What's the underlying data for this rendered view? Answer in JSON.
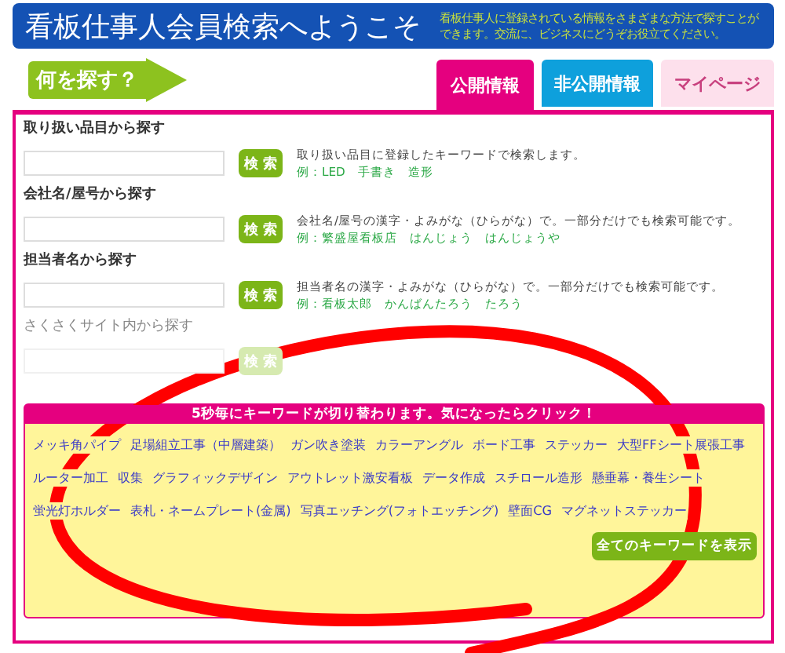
{
  "header": {
    "title": "看板仕事人会員検索へようこそ",
    "description": "看板仕事人に登録されている情報をさまざまな方法で探すことができます。交流に、ビジネスにどうぞお役立てください。"
  },
  "what_label": "何を探す？",
  "tabs": [
    {
      "label": "公開情報",
      "selected": true,
      "disabled": false,
      "color": "#e5007f"
    },
    {
      "label": "非公開情報",
      "selected": false,
      "disabled": false,
      "color": "#0ea0dc"
    },
    {
      "label": "マイページ",
      "selected": false,
      "disabled": true,
      "color": "#fde0ec"
    }
  ],
  "searches": [
    {
      "label": "取り扱い品目から探す",
      "button": "検 索",
      "description": "取り扱い品目に登録したキーワードで検索します。",
      "example": "例：LED　手書き　造形",
      "disabled": false
    },
    {
      "label": "会社名/屋号から探す",
      "button": "検 索",
      "description": "会社名/屋号の漢字・よみがな（ひらがな）で。一部分だけでも検索可能です。",
      "example": "例：繁盛屋看板店　はんじょう　はんじょうや",
      "disabled": false
    },
    {
      "label": "担当者名から探す",
      "button": "検 索",
      "description": "担当者名の漢字・よみがな（ひらがな）で。一部分だけでも検索可能です。",
      "example": "例：看板太郎　かんばんたろう　たろう",
      "disabled": false
    },
    {
      "label": "さくさくサイト内から探す",
      "button": "検 索",
      "disabled": true
    }
  ],
  "keywords": {
    "heading": "5秒毎にキーワードが切り替わります。気になったらクリック！",
    "items": [
      "メッキ角パイプ",
      "足場組立工事（中層建築）",
      "ガン吹き塗装",
      "カラーアングル",
      "ボード工事",
      "ステッカー",
      "大型FFシート展張工事",
      "ルーター加工",
      "収集",
      "グラフィックデザイン",
      "アウトレット激安看板",
      "データ作成",
      "スチロール造形",
      "懸垂幕・養生シート",
      "蛍光灯ホルダー",
      "表札・ネームプレート(金属)",
      "写真エッチング(フォトエッチング)",
      "壁面CG",
      "マグネットステッカー"
    ],
    "show_all_button": "全てのキーワードを表示"
  }
}
